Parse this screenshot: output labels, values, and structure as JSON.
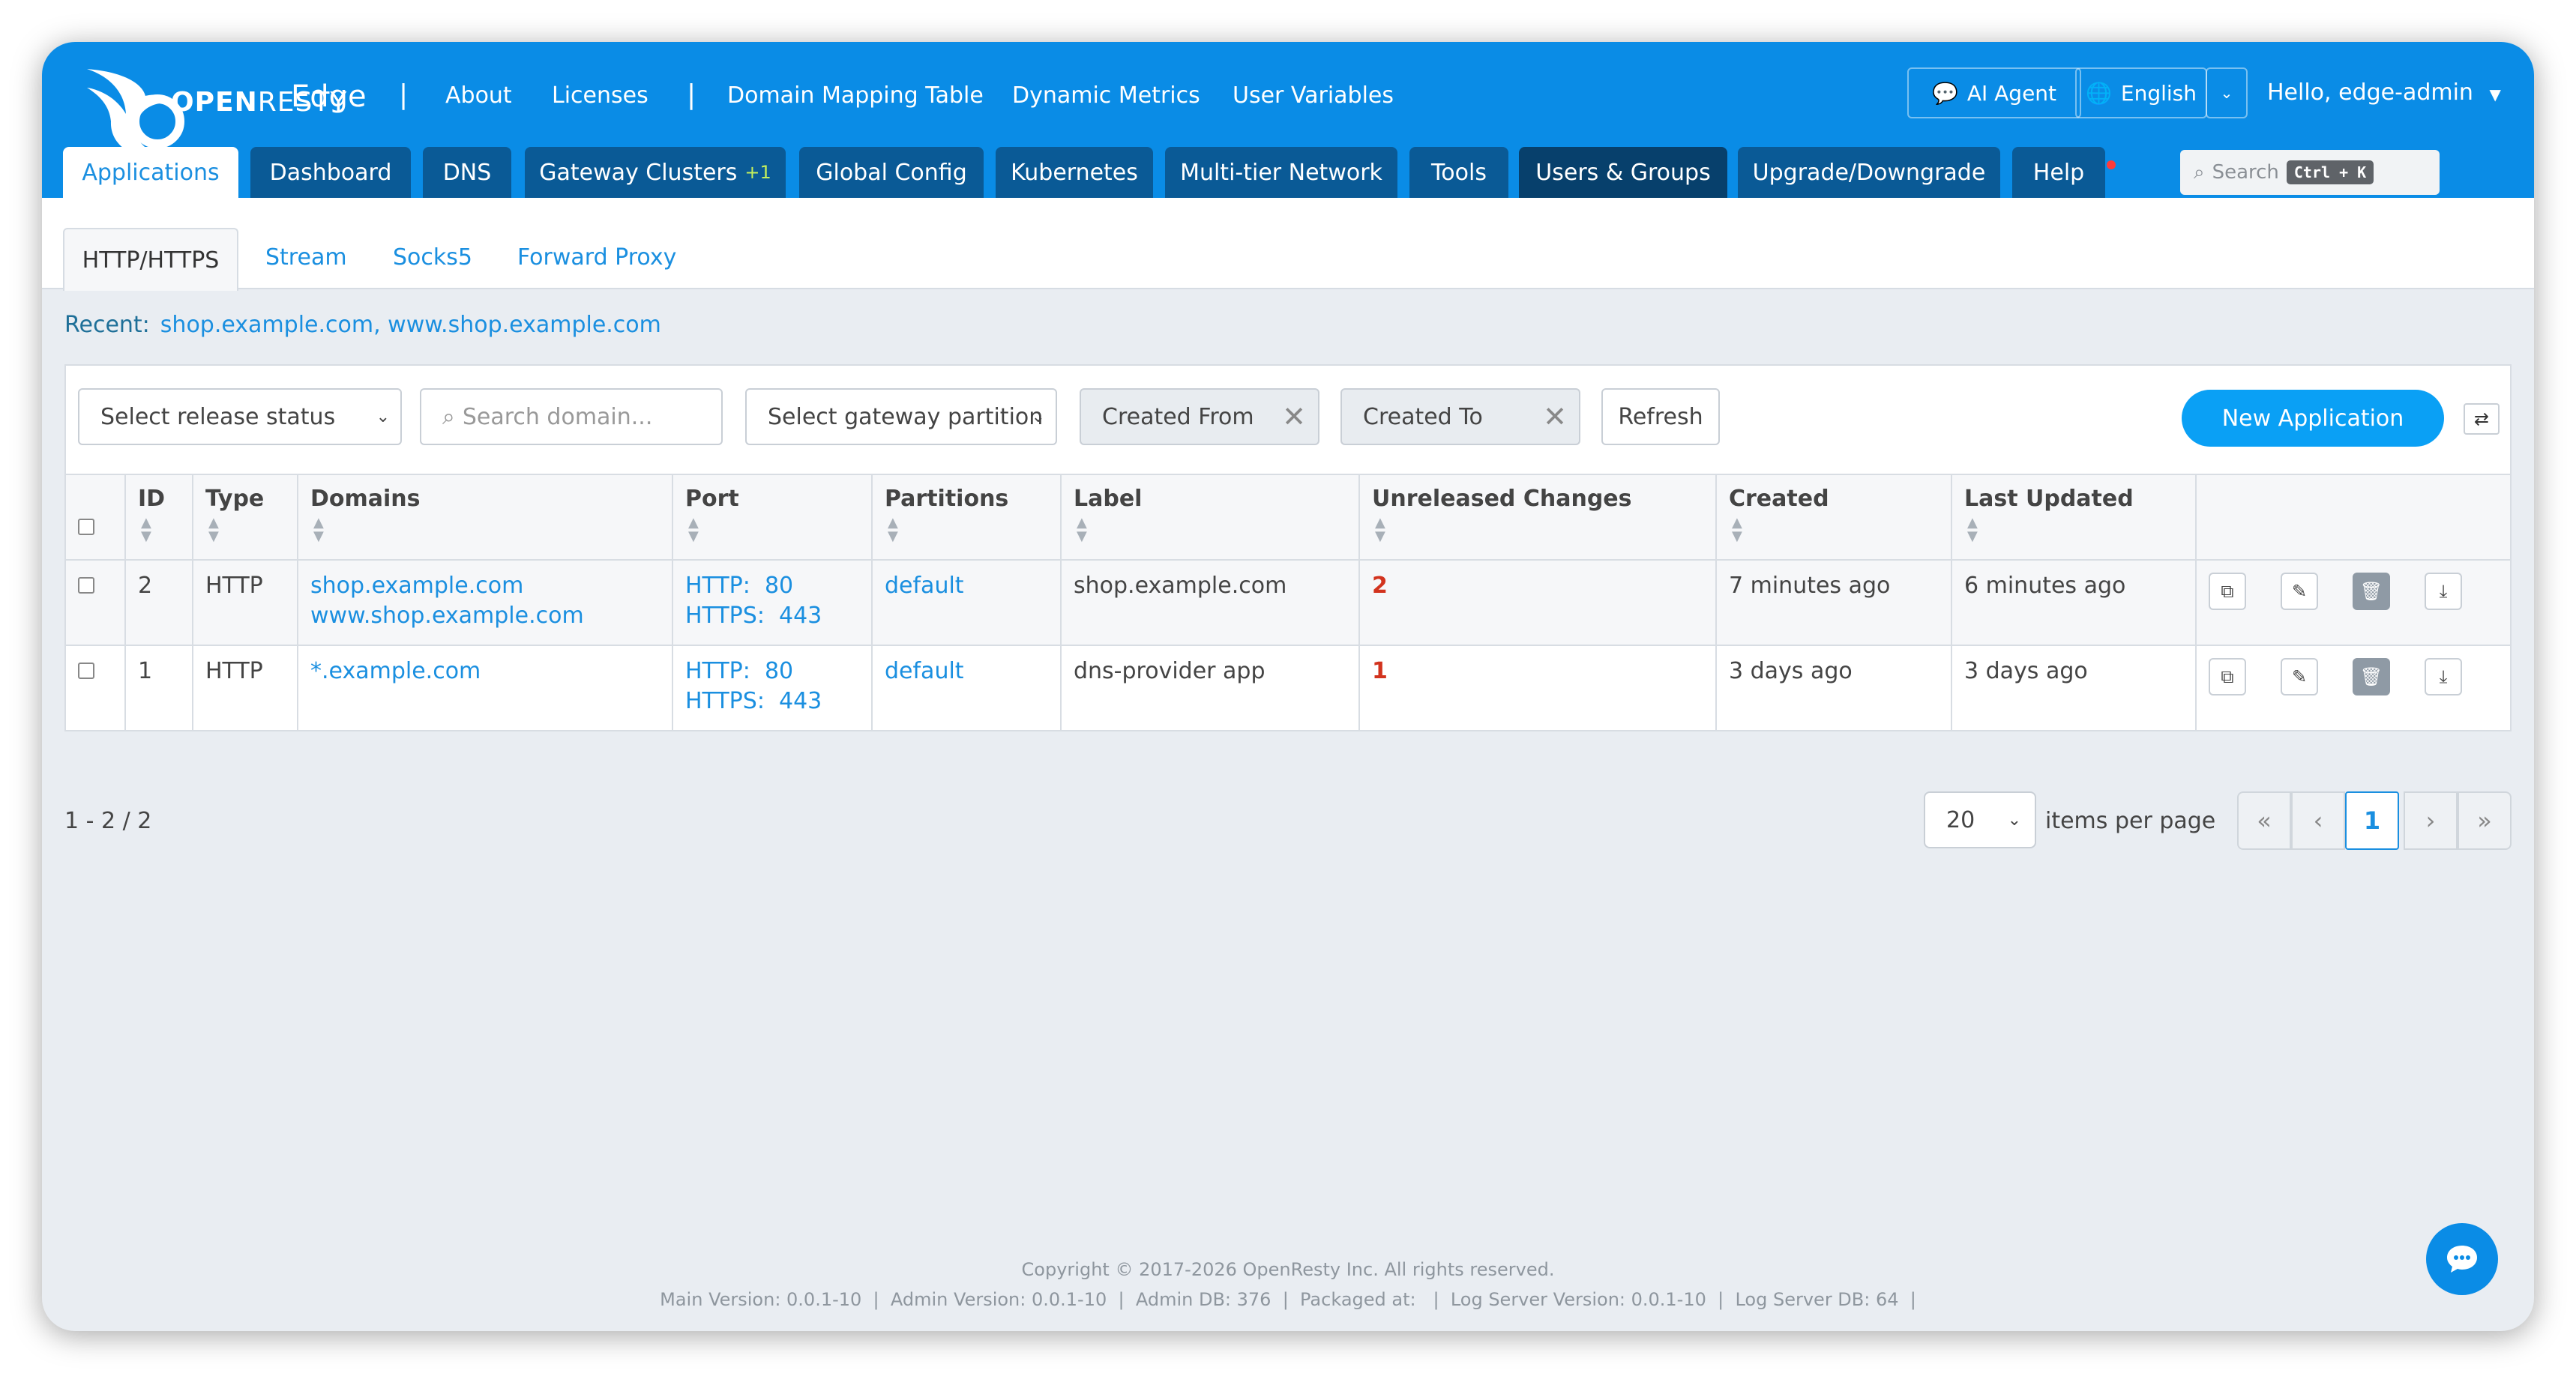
{
  "brand": {
    "name_bold": "OPEN",
    "name_rest": "RESTY",
    "product": "Edge"
  },
  "header": {
    "separator": "|",
    "links": [
      "About",
      "Licenses",
      "Domain Mapping Table",
      "Dynamic Metrics",
      "User Variables"
    ],
    "ai_agent": "AI Agent",
    "language": "English",
    "greeting": "Hello, edge-admin"
  },
  "main_tabs": [
    {
      "label": "Applications"
    },
    {
      "label": "Dashboard"
    },
    {
      "label": "DNS"
    },
    {
      "label": "Gateway Clusters",
      "badge": "+1"
    },
    {
      "label": "Global Config"
    },
    {
      "label": "Kubernetes"
    },
    {
      "label": "Multi-tier Network"
    },
    {
      "label": "Tools"
    },
    {
      "label": "Users & Groups"
    },
    {
      "label": "Upgrade/Downgrade"
    },
    {
      "label": "Help"
    }
  ],
  "search": {
    "placeholder": "Search",
    "shortcut": "Ctrl + K"
  },
  "sub_tabs": [
    "HTTP/HTTPS",
    "Stream",
    "Socks5",
    "Forward Proxy"
  ],
  "recent": {
    "label": "Recent:",
    "items": "shop.example.com, www.shop.example.com"
  },
  "filters": {
    "release_status": "Select release status",
    "domain_placeholder": "Search domain...",
    "gateway_partition": "Select gateway partition",
    "created_from": "Created From",
    "created_to": "Created To",
    "refresh": "Refresh",
    "new_app": "New Application"
  },
  "table": {
    "headers": [
      "ID",
      "Type",
      "Domains",
      "Port",
      "Partitions",
      "Label",
      "Unreleased Changes",
      "Created",
      "Last Updated"
    ],
    "rows": [
      {
        "id": "2",
        "type": "HTTP",
        "domain1": "shop.example.com",
        "domain2": "www.shop.example.com",
        "port1": "HTTP:  80",
        "port2": "HTTPS:  443",
        "partition": "default",
        "label": "shop.example.com",
        "changes": "2",
        "created": "7 minutes ago",
        "updated": "6 minutes ago"
      },
      {
        "id": "1",
        "type": "HTTP",
        "domain1": "*.example.com",
        "domain2": "",
        "port1": "HTTP:  80",
        "port2": "HTTPS:  443",
        "partition": "default",
        "label": "dns-provider app",
        "changes": "1",
        "created": "3 days ago",
        "updated": "3 days ago"
      }
    ]
  },
  "pagination": {
    "range": "1 - 2 / 2",
    "per_page": "20",
    "per_page_label": "items per page",
    "current": "1"
  },
  "footer": {
    "copyright": "Copyright © 2017-2026 OpenResty Inc. All rights reserved.",
    "versions": "Main Version: 0.0.1-10  |  Admin Version: 0.0.1-10  |  Admin DB: 376  |  Packaged at:   |  Log Server Version: 0.0.1-10  |  Log Server DB: 64  |"
  },
  "colors": {
    "brand_blue": "#0a8ce6",
    "tab_blue": "#0a5a96",
    "accent": "#0aa0f5",
    "changes_red": "#d2331e"
  }
}
